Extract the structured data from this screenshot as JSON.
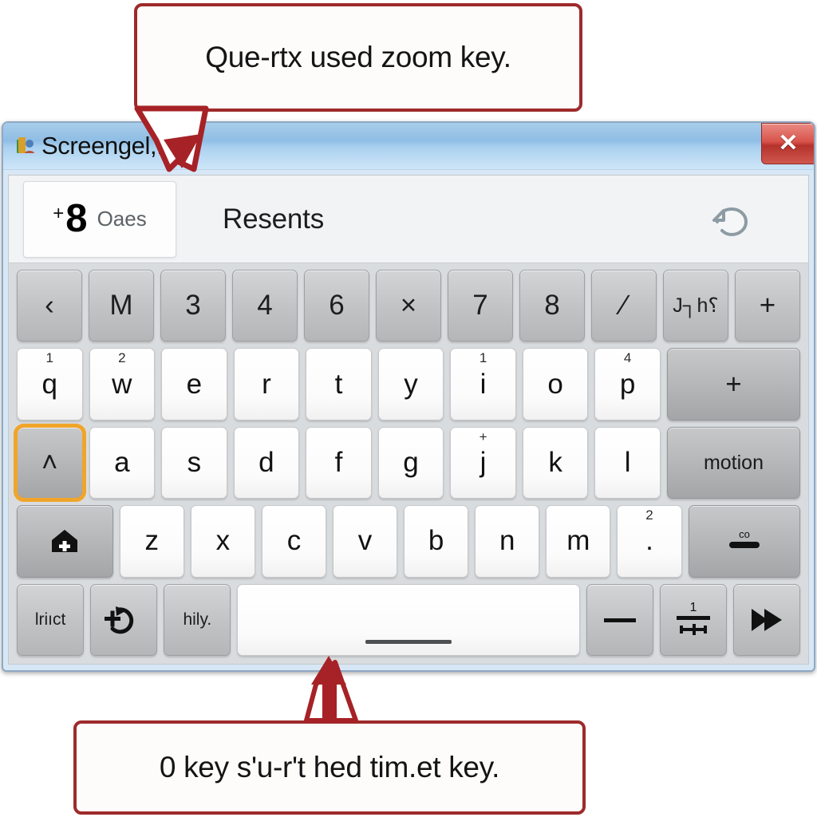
{
  "callouts": {
    "top": "Que-rtx used zoom key.",
    "bottom": "0 key s'u-r't hed tim.et key."
  },
  "window": {
    "title": "Screengel,.on",
    "title_icon": "app-icon",
    "close_label": "✕"
  },
  "toolbar": {
    "pages_plus": "+",
    "pages_count": "8",
    "pages_label": "Oaes",
    "section_title": "Resents",
    "refresh_icon": "refresh-icon"
  },
  "keyboard": {
    "rows": [
      {
        "name": "row-symbols",
        "keys": [
          {
            "label": "‹",
            "style": "gray",
            "width": "",
            "sup": ""
          },
          {
            "label": "M",
            "style": "gray",
            "width": "",
            "sup": ""
          },
          {
            "label": "3",
            "style": "gray",
            "width": "",
            "sup": ""
          },
          {
            "label": "4",
            "style": "gray",
            "width": "",
            "sup": ""
          },
          {
            "label": "6",
            "style": "gray",
            "width": "",
            "sup": ""
          },
          {
            "label": "×",
            "style": "gray",
            "width": "",
            "sup": ""
          },
          {
            "label": "7",
            "style": "gray",
            "width": "",
            "sup": ""
          },
          {
            "label": "8",
            "style": "gray",
            "width": "",
            "sup": ""
          },
          {
            "label": "∕",
            "style": "gray",
            "width": "",
            "sup": ""
          },
          {
            "label": "J┐h⸮",
            "style": "gray small",
            "width": "",
            "sup": ""
          },
          {
            "label": "+",
            "style": "gray",
            "width": "",
            "sup": ""
          }
        ]
      },
      {
        "name": "row-qwerty",
        "keys": [
          {
            "label": "q",
            "style": "white",
            "width": "",
            "sup": "1"
          },
          {
            "label": "w",
            "style": "white",
            "width": "",
            "sup": "2"
          },
          {
            "label": "e",
            "style": "white",
            "width": "",
            "sup": ""
          },
          {
            "label": "r",
            "style": "white",
            "width": "",
            "sup": ""
          },
          {
            "label": "t",
            "style": "white",
            "width": "",
            "sup": ""
          },
          {
            "label": "y",
            "style": "white",
            "width": "",
            "sup": ""
          },
          {
            "label": "i",
            "style": "white",
            "width": "",
            "sup": "1"
          },
          {
            "label": "o",
            "style": "white",
            "width": "",
            "sup": ""
          },
          {
            "label": "p",
            "style": "white",
            "width": "",
            "sup": "4"
          },
          {
            "label": "+",
            "style": "graydark",
            "width": "k-w20",
            "sup": ""
          }
        ]
      },
      {
        "name": "row-home",
        "keys": [
          {
            "label": "˄",
            "style": "graydark focused",
            "width": "",
            "sup": ""
          },
          {
            "label": "a",
            "style": "white",
            "width": "",
            "sup": ""
          },
          {
            "label": "s",
            "style": "white",
            "width": "",
            "sup": ""
          },
          {
            "label": "d",
            "style": "white",
            "width": "",
            "sup": ""
          },
          {
            "label": "f",
            "style": "white",
            "width": "",
            "sup": ""
          },
          {
            "label": "g",
            "style": "white",
            "width": "",
            "sup": ""
          },
          {
            "label": "j",
            "style": "white",
            "width": "",
            "sup": "+"
          },
          {
            "label": "k",
            "style": "white",
            "width": "",
            "sup": ""
          },
          {
            "label": "l",
            "style": "white",
            "width": "",
            "sup": ""
          },
          {
            "label": "motion",
            "style": "graydark small",
            "width": "k-w20",
            "sup": ""
          }
        ]
      },
      {
        "name": "row-bottom-letters",
        "keys": [
          {
            "label": "",
            "style": "graydark",
            "width": "k-w15",
            "sup": "",
            "icon": "home-plus-icon"
          },
          {
            "label": "z",
            "style": "white",
            "width": "",
            "sup": ""
          },
          {
            "label": "x",
            "style": "white",
            "width": "",
            "sup": ""
          },
          {
            "label": "c",
            "style": "white",
            "width": "",
            "sup": ""
          },
          {
            "label": "v",
            "style": "white",
            "width": "",
            "sup": ""
          },
          {
            "label": "b",
            "style": "white",
            "width": "",
            "sup": ""
          },
          {
            "label": "n",
            "style": "white",
            "width": "",
            "sup": ""
          },
          {
            "label": "m",
            "style": "white",
            "width": "",
            "sup": ""
          },
          {
            "label": ".",
            "style": "white",
            "width": "",
            "sup": "2"
          },
          {
            "label": "",
            "style": "graydark",
            "width": "k-w17",
            "sup": "",
            "icon": "backspace-bar-icon"
          }
        ]
      },
      {
        "name": "row-spacebar",
        "keys": [
          {
            "label": "lriıct",
            "style": "gray tiny",
            "width": "",
            "sup": ""
          },
          {
            "label": "",
            "style": "gray",
            "width": "",
            "sup": "",
            "icon": "plus-arrow-icon"
          },
          {
            "label": "hily.",
            "style": "gray tiny",
            "width": "",
            "sup": ""
          },
          {
            "label": "",
            "style": "white",
            "width": "k-space",
            "sup": "",
            "icon": "spacebar-icon"
          },
          {
            "label": "",
            "style": "gray",
            "width": "",
            "sup": "",
            "icon": "dash-icon"
          },
          {
            "label": "",
            "style": "gray",
            "width": "",
            "sup": "",
            "icon": "divider-icon"
          },
          {
            "label": "",
            "style": "gray",
            "width": "",
            "sup": "",
            "icon": "fast-forward-icon"
          }
        ]
      }
    ]
  },
  "colors": {
    "callout_border": "#9e2a2b",
    "arrow_red": "#a62226",
    "focus_highlight": "#f0a52a",
    "titlebar_blue": "#8fbde4",
    "close_red": "#c4413a"
  }
}
